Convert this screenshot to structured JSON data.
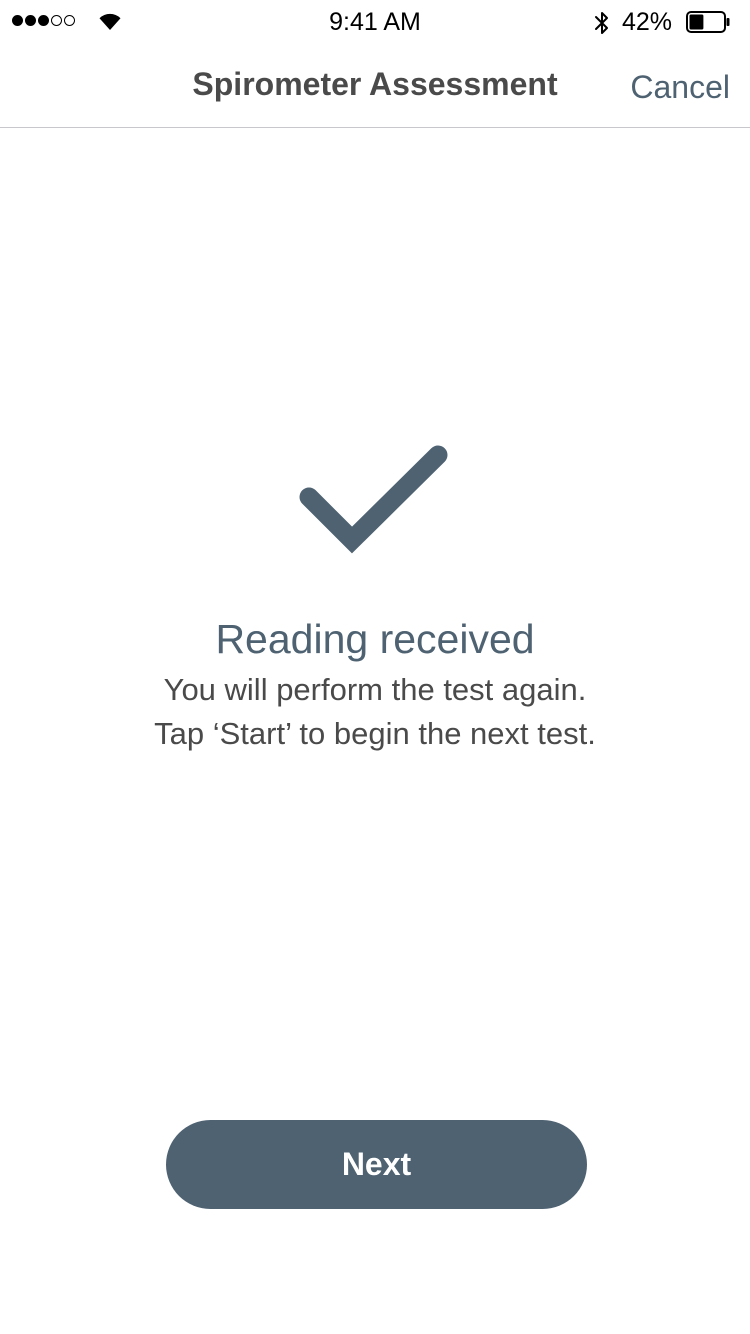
{
  "status_bar": {
    "signal_strength": 3,
    "signal_max": 5,
    "time": "9:41 AM",
    "battery_percent": "42%",
    "battery_level": 0.42
  },
  "nav": {
    "title": "Spirometer Assessment",
    "cancel_label": "Cancel"
  },
  "result": {
    "icon": "checkmark-icon",
    "title": "Reading received",
    "line1": "You will perform the test again.",
    "line2": "Tap ‘Start’ to begin the next test."
  },
  "actions": {
    "next_label": "Next"
  },
  "colors": {
    "accent": "#4e6272",
    "text": "#4a4a4a",
    "divider": "#c8c8cc"
  }
}
